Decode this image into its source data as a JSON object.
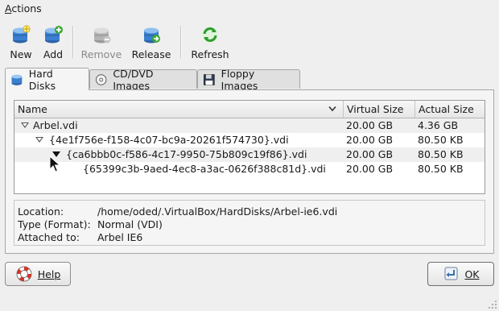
{
  "menubar": {
    "actions_label": "Actions",
    "actions_mnemonic_rest": "ctions",
    "actions_mnemonic": "A"
  },
  "toolbar": {
    "new_label": "New",
    "add_label": "Add",
    "remove_label": "Remove",
    "release_label": "Release",
    "refresh_label": "Refresh"
  },
  "tabs": {
    "hard_disks": "Hard Disks",
    "cd_dvd": "CD/DVD Images",
    "floppy": "Floppy Images"
  },
  "table": {
    "columns": {
      "name": "Name",
      "virtual_size": "Virtual Size",
      "actual_size": "Actual Size"
    },
    "rows": [
      {
        "name": "Arbel.vdi",
        "virtual": "20.00 GB",
        "actual": "4.36 GB"
      },
      {
        "name": "{4e1f756e-f158-4c07-bc9a-20261f574730}.vdi",
        "virtual": "20.00 GB",
        "actual": "80.50 KB"
      },
      {
        "name": "{ca6bbb0c-f586-4c17-9950-75b809c19f86}.vdi",
        "virtual": "20.00 GB",
        "actual": "80.50 KB"
      },
      {
        "name": "{65399c3b-9aed-4ec8-a3ac-0626f388c81d}.vdi",
        "virtual": "20.00 GB",
        "actual": "80.50 KB"
      }
    ]
  },
  "info": {
    "location_label": "Location:",
    "location_value": "/home/oded/.VirtualBox/HardDisks/Arbel-ie6.vdi",
    "type_label": "Type (Format):",
    "type_value": "Normal (VDI)",
    "attached_label": "Attached to:",
    "attached_value": "Arbel IE6"
  },
  "buttons": {
    "help_label": "Help",
    "ok_label": "OK"
  },
  "icons": {
    "new": "hard-disk-new-icon",
    "add": "hard-disk-add-icon",
    "remove": "hard-disk-remove-icon",
    "release": "hard-disk-release-icon",
    "refresh": "refresh-icon"
  },
  "colors": {
    "disk_blue": "#3a7fd0",
    "add_green": "#3aa832",
    "refresh_green": "#2e9c2e"
  }
}
